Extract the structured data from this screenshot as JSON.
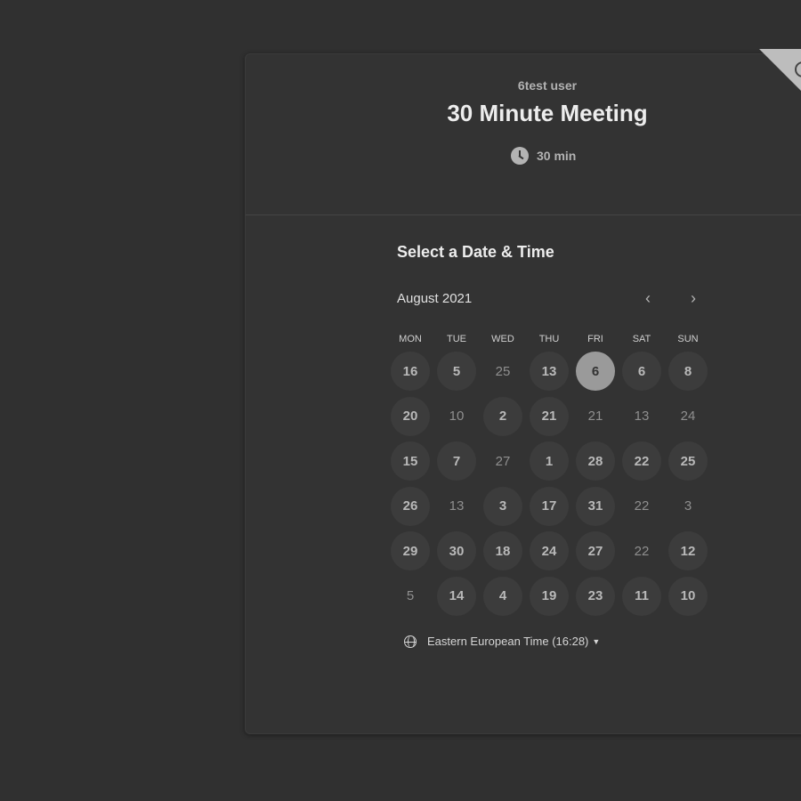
{
  "header": {
    "host": "6test user",
    "title": "30 Minute Meeting",
    "duration": "30 min",
    "duration_icon": "clock-icon"
  },
  "calendar": {
    "section_title": "Select a Date & Time",
    "month_label": "August 2021",
    "prev_label": "‹",
    "next_label": "›",
    "weekdays": [
      "MON",
      "TUE",
      "WED",
      "THU",
      "FRI",
      "SAT",
      "SUN"
    ],
    "days": [
      {
        "label": "16",
        "state": "available"
      },
      {
        "label": "5",
        "state": "available"
      },
      {
        "label": "25",
        "state": "unavailable"
      },
      {
        "label": "13",
        "state": "available"
      },
      {
        "label": "6",
        "state": "selected"
      },
      {
        "label": "6",
        "state": "available"
      },
      {
        "label": "8",
        "state": "available"
      },
      {
        "label": "20",
        "state": "available"
      },
      {
        "label": "10",
        "state": "unavailable"
      },
      {
        "label": "2",
        "state": "available"
      },
      {
        "label": "21",
        "state": "available"
      },
      {
        "label": "21",
        "state": "unavailable"
      },
      {
        "label": "13",
        "state": "unavailable"
      },
      {
        "label": "24",
        "state": "unavailable"
      },
      {
        "label": "15",
        "state": "available"
      },
      {
        "label": "7",
        "state": "available"
      },
      {
        "label": "27",
        "state": "unavailable"
      },
      {
        "label": "1",
        "state": "available"
      },
      {
        "label": "28",
        "state": "available"
      },
      {
        "label": "22",
        "state": "available"
      },
      {
        "label": "25",
        "state": "available"
      },
      {
        "label": "26",
        "state": "available"
      },
      {
        "label": "13",
        "state": "unavailable"
      },
      {
        "label": "3",
        "state": "available"
      },
      {
        "label": "17",
        "state": "available"
      },
      {
        "label": "31",
        "state": "available"
      },
      {
        "label": "22",
        "state": "unavailable"
      },
      {
        "label": "3",
        "state": "unavailable"
      },
      {
        "label": "29",
        "state": "available"
      },
      {
        "label": "30",
        "state": "available"
      },
      {
        "label": "18",
        "state": "available"
      },
      {
        "label": "24",
        "state": "available"
      },
      {
        "label": "27",
        "state": "available"
      },
      {
        "label": "22",
        "state": "unavailable"
      },
      {
        "label": "12",
        "state": "available"
      },
      {
        "label": "5",
        "state": "unavailable"
      },
      {
        "label": "14",
        "state": "available"
      },
      {
        "label": "4",
        "state": "available"
      },
      {
        "label": "19",
        "state": "available"
      },
      {
        "label": "23",
        "state": "available"
      },
      {
        "label": "11",
        "state": "available"
      },
      {
        "label": "10",
        "state": "available"
      }
    ]
  },
  "timezone": {
    "label": "Eastern European Time (16:28)",
    "icon": "globe-icon",
    "caret": "▼"
  },
  "colors": {
    "page_background": "#303030",
    "card_background": "#333333",
    "available_day": "#3c3c3c",
    "selected_day": "#9a9a9a"
  }
}
